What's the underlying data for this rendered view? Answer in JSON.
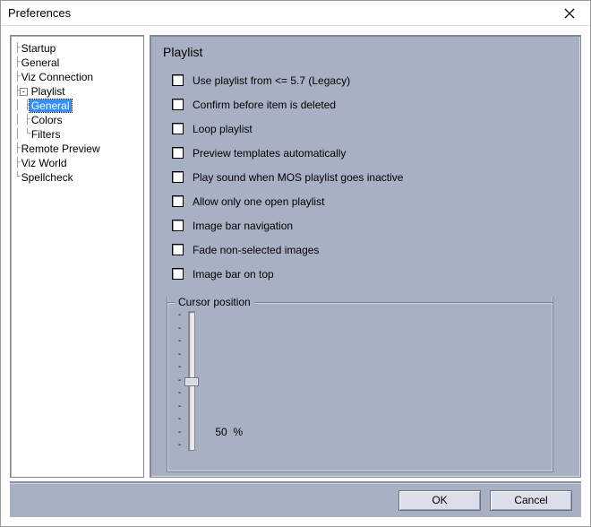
{
  "window": {
    "title": "Preferences"
  },
  "tree": {
    "items": [
      {
        "label": "Startup",
        "level": 0,
        "exp": null
      },
      {
        "label": "General",
        "level": 0,
        "exp": null
      },
      {
        "label": "Viz Connection",
        "level": 0,
        "exp": null
      },
      {
        "label": "Playlist",
        "level": 0,
        "exp": "-"
      },
      {
        "label": "General",
        "level": 1,
        "exp": null,
        "selected": true
      },
      {
        "label": "Colors",
        "level": 1,
        "exp": null
      },
      {
        "label": "Filters",
        "level": 1,
        "exp": null
      },
      {
        "label": "Remote Preview",
        "level": 0,
        "exp": null
      },
      {
        "label": "Viz World",
        "level": 0,
        "exp": null
      },
      {
        "label": "Spellcheck",
        "level": 0,
        "exp": null
      }
    ]
  },
  "panel": {
    "title": "Playlist",
    "checks": [
      "Use playlist from <= 5.7 (Legacy)",
      "Confirm before item is deleted",
      "Loop playlist",
      "Preview templates automatically",
      "Play sound when MOS playlist goes inactive",
      "Allow only one open playlist",
      "Image bar navigation",
      "Fade non-selected images",
      "Image bar on top"
    ],
    "group": {
      "legend": "Cursor position",
      "value": "50",
      "unit": "%"
    }
  },
  "footer": {
    "ok": "OK",
    "cancel": "Cancel"
  }
}
